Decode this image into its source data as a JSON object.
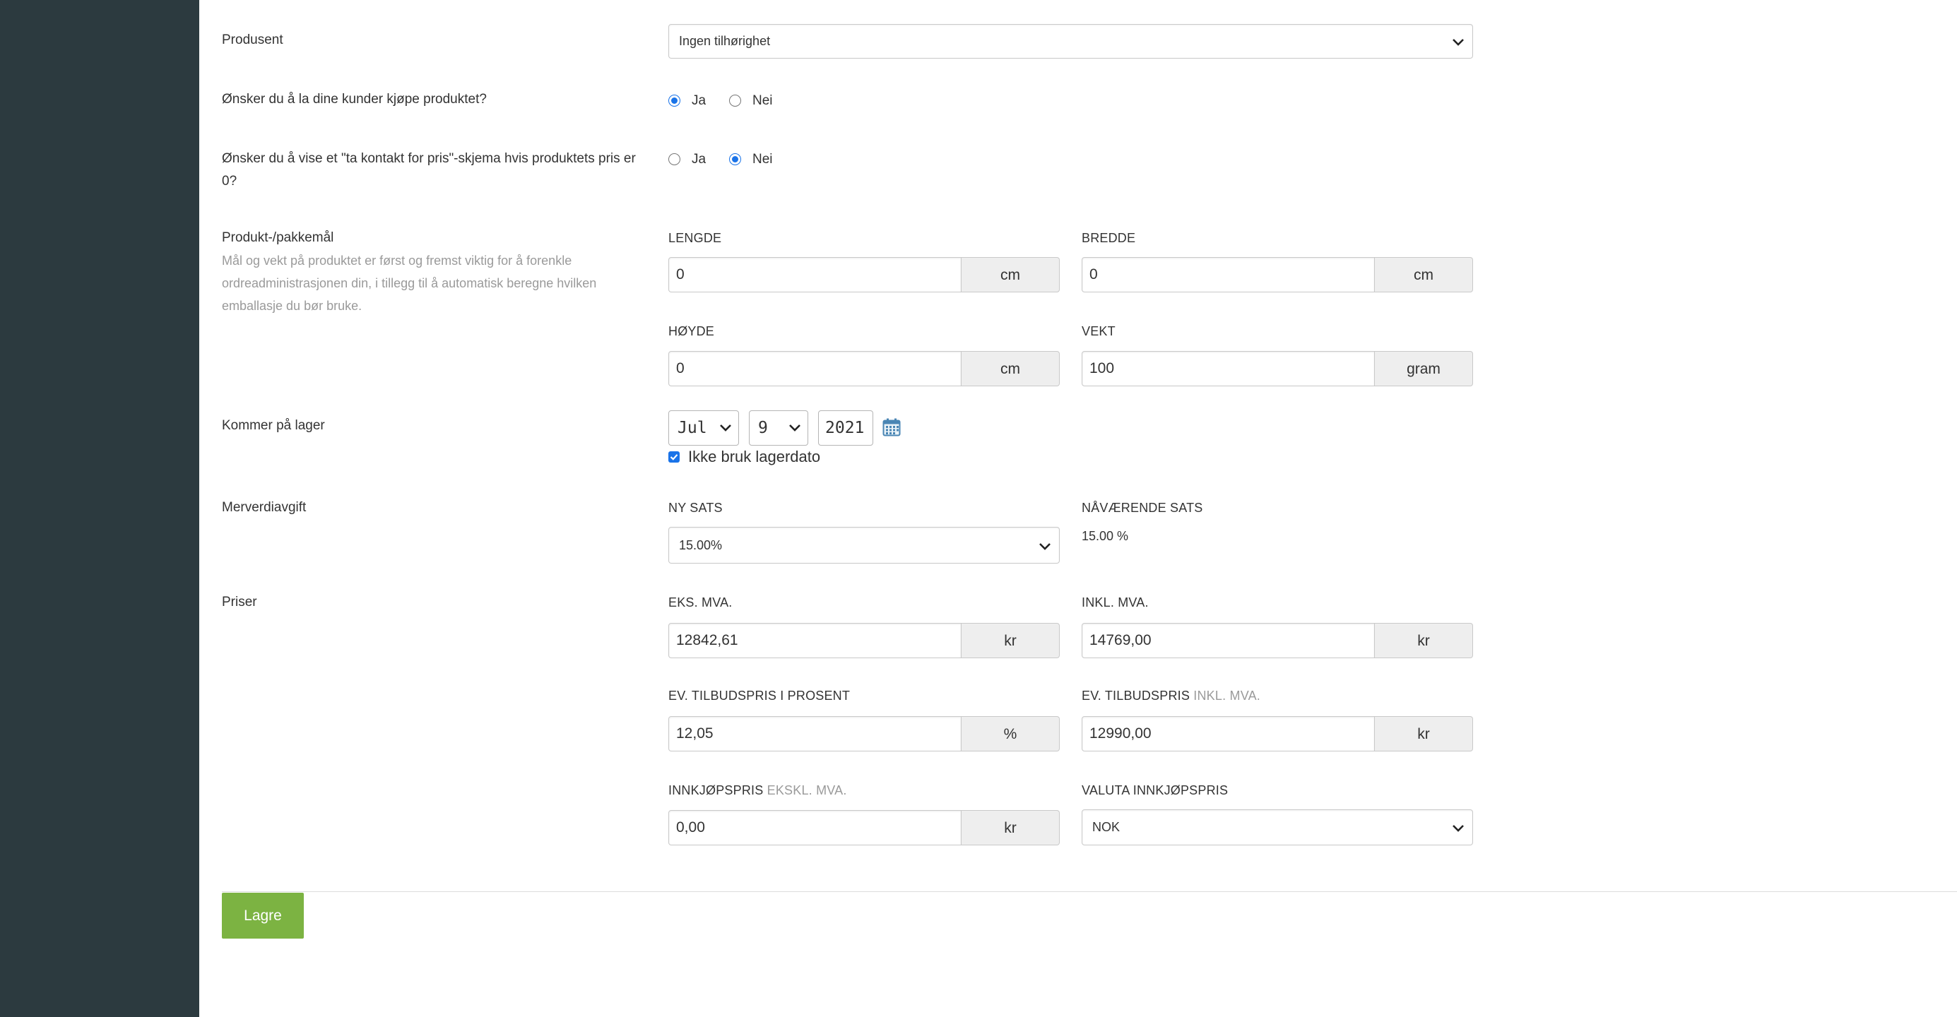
{
  "producer": {
    "label": "Produsent",
    "selected": "Ingen tilhørighet"
  },
  "allow_purchase": {
    "label": "Ønsker du å la dine kunder kjøpe produktet?",
    "options": [
      "Ja",
      "Nei"
    ],
    "selected": "Ja"
  },
  "contact_for_price": {
    "label_line1": "Ønsker du å vise et \"ta kontakt for pris\"-skjema hvis produktets pris er",
    "label_line2": "0?",
    "options": [
      "Ja",
      "Nei"
    ],
    "selected": "Nei"
  },
  "dimensions": {
    "label": "Produkt-/pakkemål",
    "help_line1": "Mål og vekt på produktet er først og fremst viktig for å forenkle",
    "help_line2": "ordreadministrasjonen din, i tillegg til å automatisk beregne hvilken",
    "help_line3": "emballasje du bør bruke.",
    "length": {
      "label": "LENGDE",
      "value": "0",
      "unit": "cm"
    },
    "width": {
      "label": "BREDDE",
      "value": "0",
      "unit": "cm"
    },
    "height": {
      "label": "HØYDE",
      "value": "0",
      "unit": "cm"
    },
    "weight": {
      "label": "VEKT",
      "value": "100",
      "unit": "gram"
    }
  },
  "stock_date": {
    "label": "Kommer på lager",
    "month": "Jul",
    "day": "9",
    "year": "2021",
    "checkbox_label": "Ikke bruk lagerdato",
    "checkbox_checked": true
  },
  "vat": {
    "label": "Merverdiavgift",
    "new_rate_label": "NY SATS",
    "new_rate_value": "15.00%",
    "current_rate_label": "NÅVÆRENDE SATS",
    "current_rate_value": "15.00 %"
  },
  "prices": {
    "label": "Priser",
    "excl_vat": {
      "label": "EKS. MVA.",
      "value": "12842,61",
      "unit": "kr"
    },
    "incl_vat": {
      "label": "INKL. MVA.",
      "value": "14769,00",
      "unit": "kr"
    },
    "offer_percent": {
      "label": "EV. TILBUDSPRIS I PROSENT",
      "value": "12,05",
      "unit": "%"
    },
    "offer_price": {
      "label": "EV. TILBUDSPRIS",
      "label_muted": "INKL. MVA.",
      "value": "12990,00",
      "unit": "kr"
    },
    "purchase_price": {
      "label": "INNKJØPSPRIS",
      "label_muted": "EKSKL. MVA.",
      "value": "0,00",
      "unit": "kr"
    },
    "purchase_currency": {
      "label": "VALUTA INNKJØPSPRIS",
      "value": "NOK"
    }
  },
  "save_button": "Lagre",
  "colors": {
    "sidebar": "#2c3a3f",
    "accent_green": "#7cb342",
    "radio_blue": "#1a73e8"
  }
}
